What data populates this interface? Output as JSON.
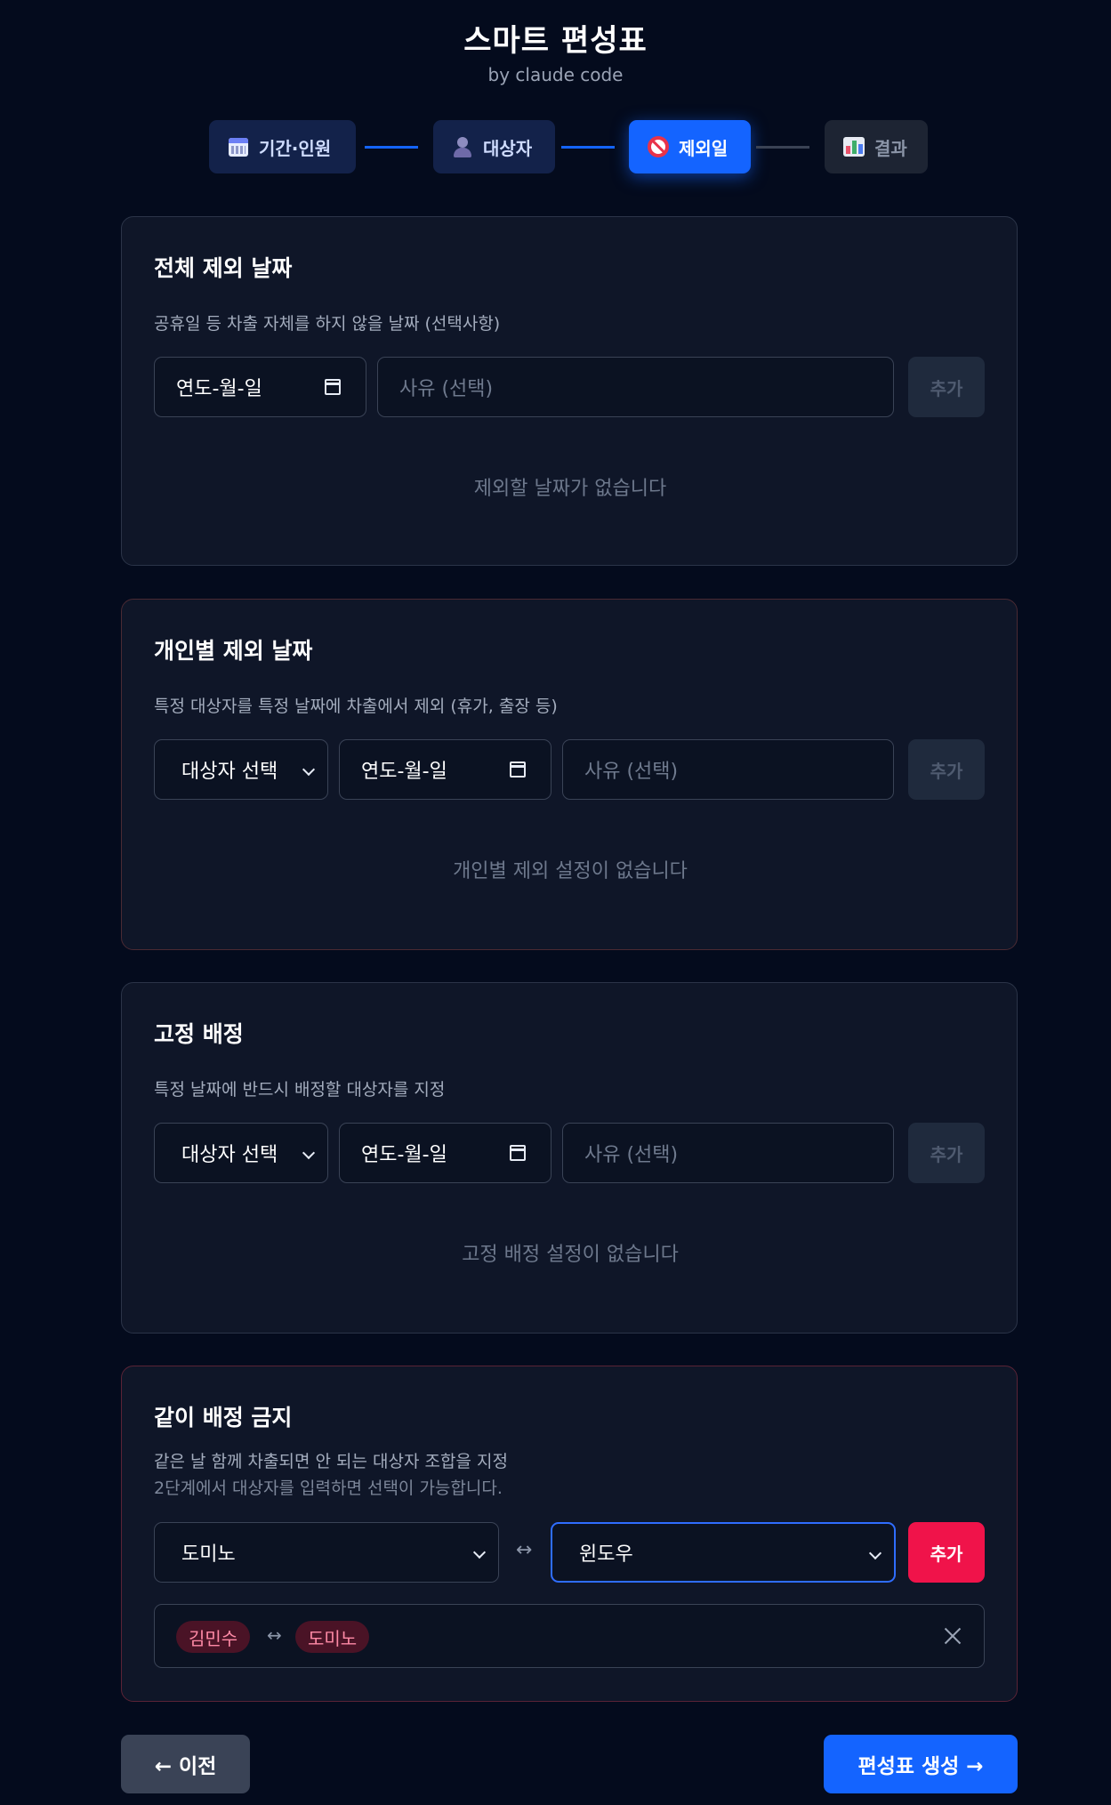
{
  "header": {
    "title": "스마트 편성표",
    "subtitle": "by claude code"
  },
  "stepper": {
    "steps": [
      {
        "label": "기간·인원",
        "icon": "calendar-icon",
        "state": "done"
      },
      {
        "label": "대상자",
        "icon": "person-icon",
        "state": "done"
      },
      {
        "label": "제외일",
        "icon": "no-entry-icon",
        "state": "active"
      },
      {
        "label": "결과",
        "icon": "bar-chart-icon",
        "state": "todo"
      }
    ]
  },
  "global_exclusion": {
    "title": "전체 제외 날짜",
    "description": "공휴일 등 차출 자체를 하지 않을 날짜 (선택사항)",
    "date_placeholder": "연도-월-일",
    "reason_placeholder": "사유 (선택)",
    "add_label": "추가",
    "empty_message": "제외할 날짜가 없습니다"
  },
  "personal_exclusion": {
    "title": "개인별 제외 날짜",
    "description": "특정 대상자를 특정 날짜에 차출에서 제외 (휴가, 출장 등)",
    "person_select": "대상자 선택",
    "date_placeholder": "연도-월-일",
    "reason_placeholder": "사유 (선택)",
    "add_label": "추가",
    "empty_message": "개인별 제외 설정이 없습니다"
  },
  "fixed_assignment": {
    "title": "고정 배정",
    "description": "특정 날짜에 반드시 배정할 대상자를 지정",
    "person_select": "대상자 선택",
    "date_placeholder": "연도-월-일",
    "reason_placeholder": "사유 (선택)",
    "add_label": "추가",
    "empty_message": "고정 배정 설정이 없습니다"
  },
  "conflict_pairs": {
    "title": "같이 배정 금지",
    "description": "같은 날 함께 차출되면 안 되는 대상자 조합을 지정",
    "hint": "2단계에서 대상자를 입력하면 선택이 가능합니다.",
    "first_select": "도미노",
    "second_select": "윈도우",
    "swap_symbol": "↔",
    "add_label": "추가",
    "pairs": [
      {
        "a": "김민수",
        "b": "도미노",
        "sep": "↔"
      }
    ]
  },
  "navigation": {
    "prev_label": "← 이전",
    "next_label": "편성표 생성 →"
  },
  "colors": {
    "background": "#040b1d",
    "card": "#0f1628",
    "accent": "#1464ff",
    "danger": "#f0134a"
  }
}
